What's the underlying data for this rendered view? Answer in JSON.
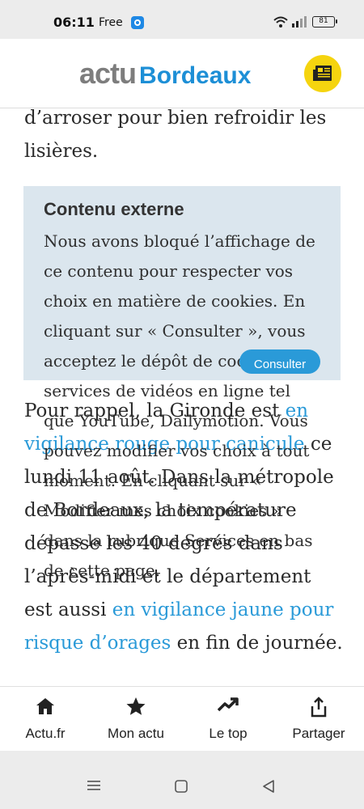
{
  "status": {
    "time": "06:11",
    "carrier": "Free",
    "battery": "81"
  },
  "header": {
    "logo_part1": "actu",
    "logo_part2": "Bordeaux",
    "news_icon": "newspaper-icon"
  },
  "article": {
    "para1": "d’arroser pour bien refroidir les lisières.",
    "para2": {
      "t1": "Pour rappel, la Gironde est ",
      "l1": "en vigilance rouge pour canicule",
      "t2": " ce lundi 11 août. Dans la métropole de Bordeaux, la température dépasse les 40 degrés dans l’après-midi et le département est aussi ",
      "l2": "en vigilance jaune pour risque d’orages",
      "t3": " en fin de journée."
    }
  },
  "cookie": {
    "title": "Contenu externe",
    "text": "Nous avons bloqué l’affichage de ce contenu pour respecter vos choix en matière de cookies. En cliquant sur « Consulter », vous acceptez le dépôt de cookies des services de vidéos en ligne tel que YouTube, Dailymotion. Vous pouvez modifier vos choix à tout moment. En cliquant sur « Modifier mes choix cookies » dans la rubrique Services en bas de cette page.",
    "button": "Consulter"
  },
  "bottom_nav": [
    {
      "label": "Actu.fr",
      "icon": "home-icon"
    },
    {
      "label": "Mon actu",
      "icon": "star-icon"
    },
    {
      "label": "Le top",
      "icon": "trending-icon"
    },
    {
      "label": "Partager",
      "icon": "share-icon"
    }
  ],
  "system_nav": {
    "icons": [
      "menu-icon",
      "home-square-icon",
      "back-icon"
    ]
  },
  "colors": {
    "accent": "#2a9ad8",
    "logo_grey": "#7d7d7d",
    "badge_yellow": "#f5d40f",
    "cookie_bg": "#dbe6ee"
  }
}
